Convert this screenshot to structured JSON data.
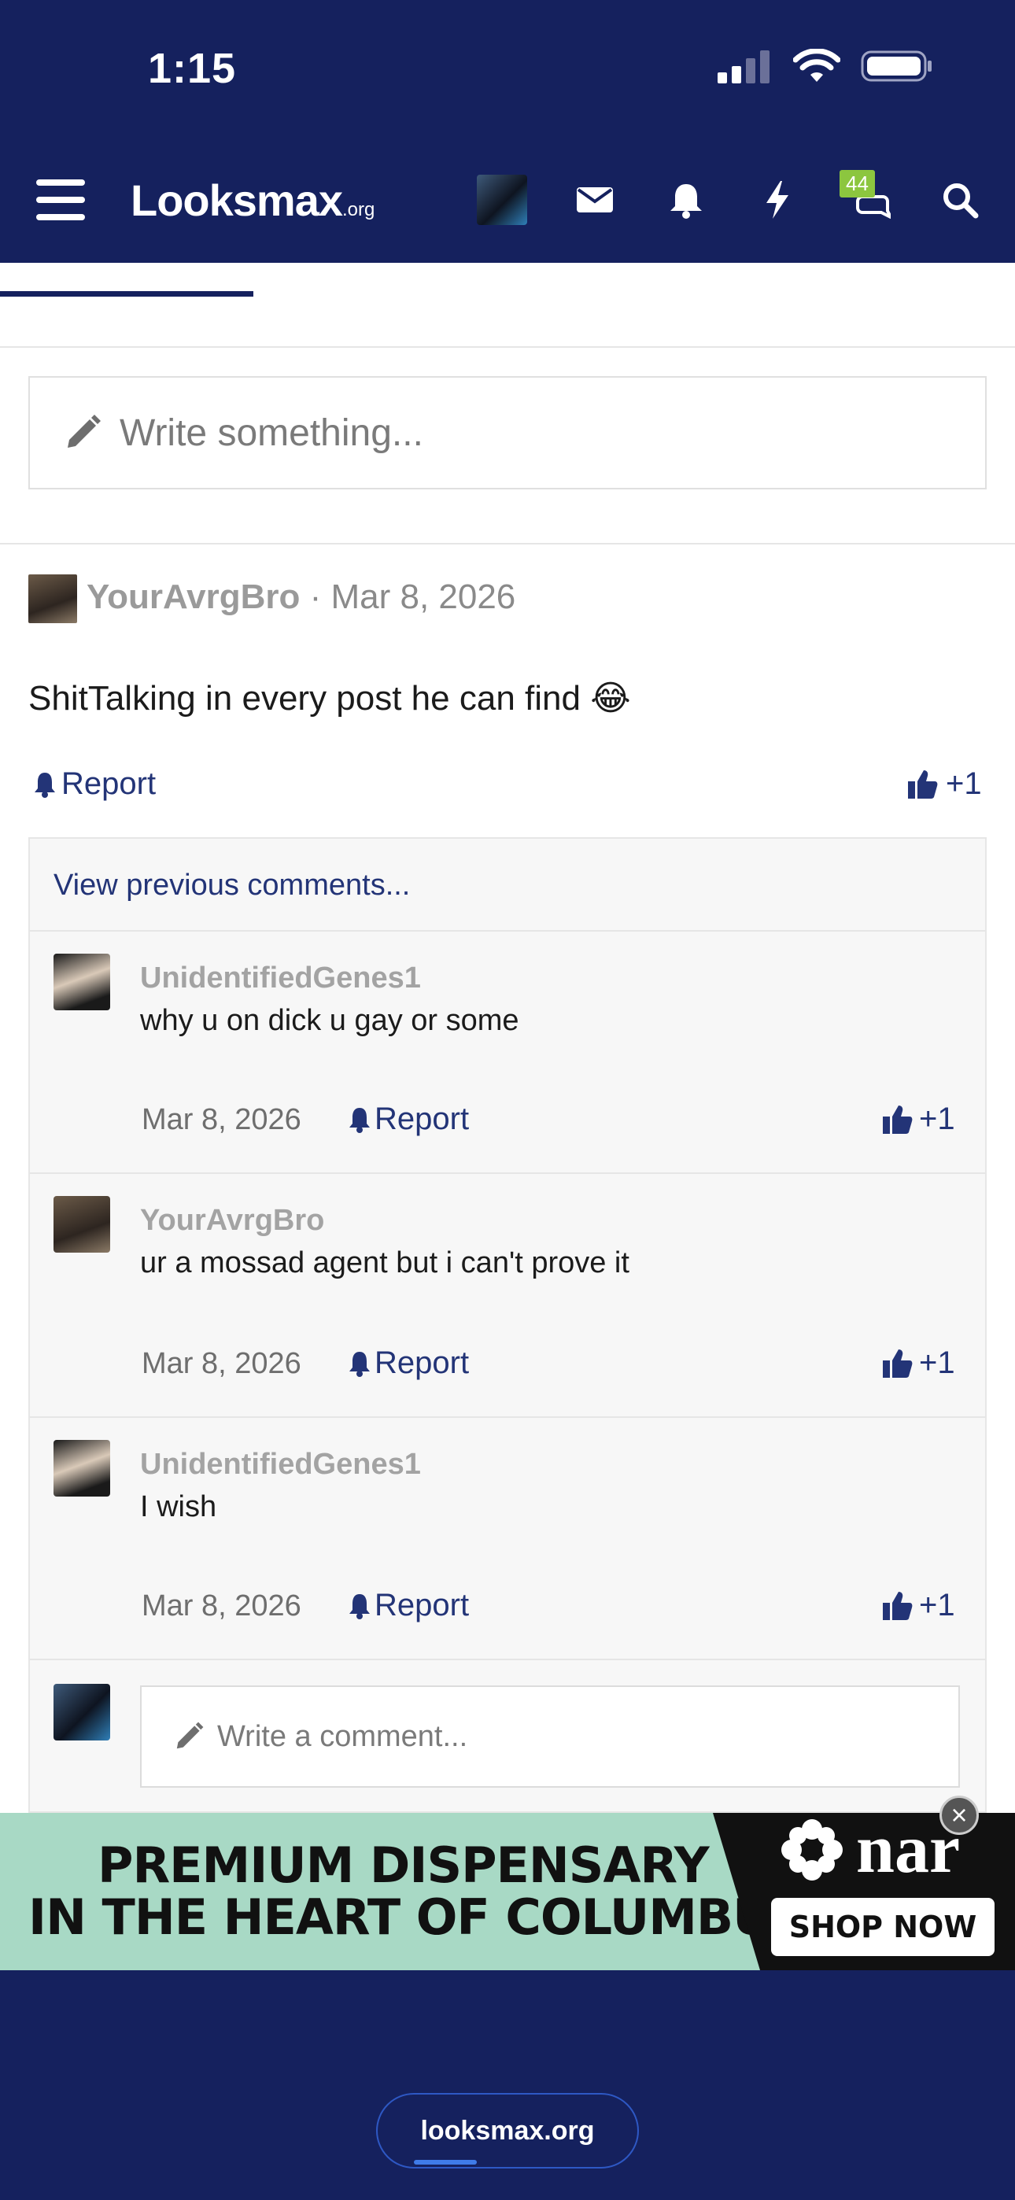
{
  "status_bar": {
    "time": "1:15"
  },
  "header": {
    "logo": "Looksmax",
    "logo_suffix": ".org",
    "notifications_badge": "44",
    "icons": [
      "menu-icon",
      "avatar",
      "mail-icon",
      "bell-icon",
      "lightning-icon",
      "chat-icon",
      "search-icon"
    ]
  },
  "composer": {
    "placeholder": "Write something..."
  },
  "post": {
    "author": "YourAvrgBro",
    "date": "· Mar 8, 2026",
    "text": "ShitTalking in every post he can find",
    "emoji": "😂",
    "report": "Report",
    "likes": "+1"
  },
  "comments": {
    "view_previous": "View previous comments...",
    "items": [
      {
        "author": "UnidentifiedGenes1",
        "text": "why u on dick u gay or some",
        "date": "Mar 8, 2026",
        "report": "Report",
        "likes": "+1"
      },
      {
        "author": "YourAvrgBro",
        "text": "ur a mossad agent but i can't prove it",
        "date": "Mar 8, 2026",
        "report": "Report",
        "likes": "+1"
      },
      {
        "author": "UnidentifiedGenes1",
        "text": "I wish",
        "date": "Mar 8, 2026",
        "report": "Report",
        "likes": "+1"
      }
    ],
    "comment_placeholder": "Write a comment..."
  },
  "ad": {
    "line1": "PREMIUM DISPENSARY",
    "line2": "IN THE HEART OF COLUMBUS",
    "brand": "nar",
    "cta": "SHOP NOW",
    "close": "×"
  },
  "browser": {
    "url": "looksmax.org"
  },
  "colors": {
    "header_bg": "#15215e",
    "link": "#233477",
    "badge": "#8cc63f",
    "ad_bg": "#a8d9c5"
  }
}
